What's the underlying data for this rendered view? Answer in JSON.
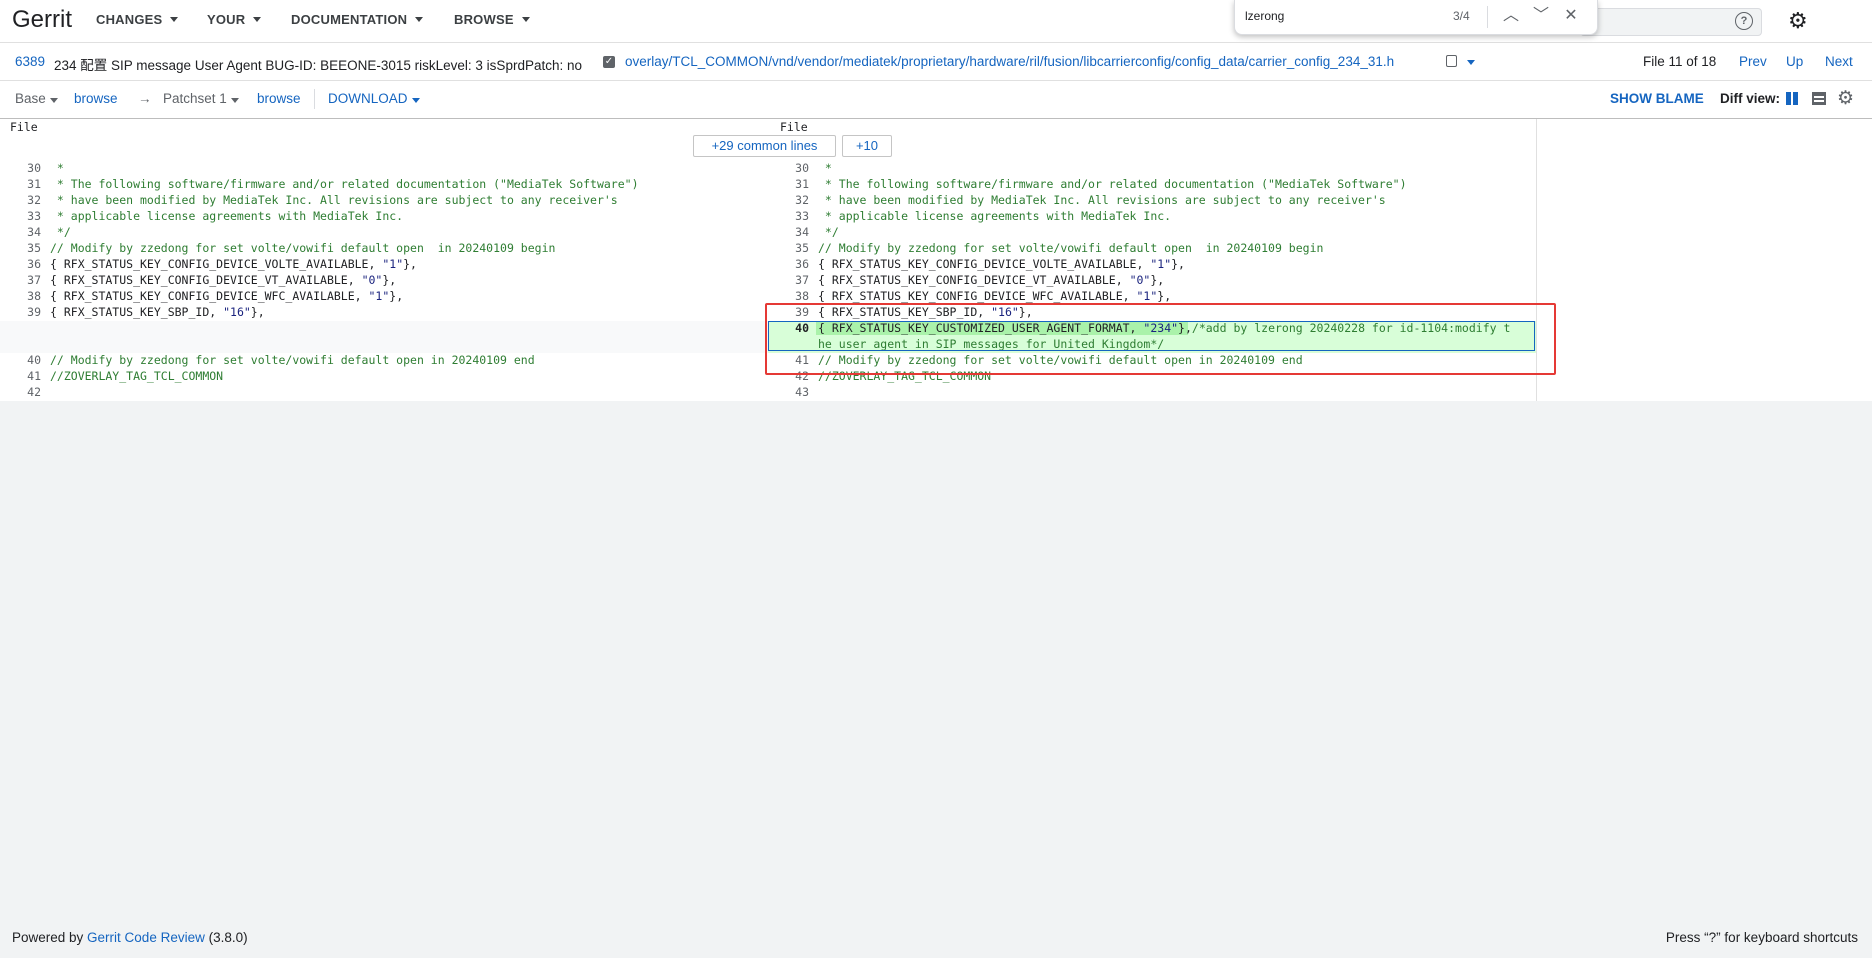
{
  "topbar": {
    "logo": "Gerrit",
    "menus": [
      "CHANGES",
      "YOUR",
      "DOCUMENTATION",
      "BROWSE"
    ]
  },
  "findbar": {
    "query": "lzerong",
    "count": "3/4"
  },
  "change": {
    "number": "6389",
    "subject": "234 配置 SIP message User Agent BUG-ID: BEEONE-3015 riskLevel: 3 isSprdPatch: no",
    "path": "overlay/TCL_COMMON/vnd/vendor/mediatek/proprietary/hardware/ril/fusion/libcarrierconfig/config_data/carrier_config_234_31.h",
    "file_of": "File 11 of 18",
    "nav": {
      "prev": "Prev",
      "up": "Up",
      "next": "Next"
    }
  },
  "patchbar": {
    "base": "Base",
    "browse1": "browse",
    "arrow": "→",
    "patchset": "Patchset 1",
    "browse2": "browse",
    "download": "DOWNLOAD",
    "blame": "SHOW BLAME",
    "diffview": "Diff view:"
  },
  "diff": {
    "file_left": "File",
    "file_right": "File",
    "common_lines": "+29 common lines",
    "more": "+10",
    "left_lines": [
      {
        "n": "30",
        "code": " *"
      },
      {
        "n": "31",
        "code": " * The following software/firmware and/or related documentation (\"MediaTek Software\")"
      },
      {
        "n": "32",
        "code": " * have been modified by MediaTek Inc. All revisions are subject to any receiver's"
      },
      {
        "n": "33",
        "code": " * applicable license agreements with MediaTek Inc."
      },
      {
        "n": "34",
        "code": " */"
      },
      {
        "n": "35",
        "code": "// Modify by zzedong for set volte/vowifi default open  in 20240109 begin"
      },
      {
        "n": "36",
        "code": "{ RFX_STATUS_KEY_CONFIG_DEVICE_VOLTE_AVAILABLE, \"1\"},"
      },
      {
        "n": "37",
        "code": "{ RFX_STATUS_KEY_CONFIG_DEVICE_VT_AVAILABLE, \"0\"},"
      },
      {
        "n": "38",
        "code": "{ RFX_STATUS_KEY_CONFIG_DEVICE_WFC_AVAILABLE, \"1\"},"
      },
      {
        "n": "39",
        "code": "{ RFX_STATUS_KEY_SBP_ID, \"16\"},"
      },
      {
        "n": "40",
        "code": "// Modify by zzedong for set volte/vowifi default open in 20240109 end"
      },
      {
        "n": "41",
        "code": "//ZOVERLAY_TAG_TCL_COMMON"
      },
      {
        "n": "42",
        "code": ""
      }
    ],
    "right_lines": [
      {
        "n": "30",
        "code": " *"
      },
      {
        "n": "31",
        "code": " * The following software/firmware and/or related documentation (\"MediaTek Software\")"
      },
      {
        "n": "32",
        "code": " * have been modified by MediaTek Inc. All revisions are subject to any receiver's"
      },
      {
        "n": "33",
        "code": " * applicable license agreements with MediaTek Inc."
      },
      {
        "n": "34",
        "code": " */"
      },
      {
        "n": "35",
        "code": "// Modify by zzedong for set volte/vowifi default open  in 20240109 begin"
      },
      {
        "n": "36",
        "code": "{ RFX_STATUS_KEY_CONFIG_DEVICE_VOLTE_AVAILABLE, \"1\"},"
      },
      {
        "n": "37",
        "code": "{ RFX_STATUS_KEY_CONFIG_DEVICE_VT_AVAILABLE, \"0\"},"
      },
      {
        "n": "38",
        "code": "{ RFX_STATUS_KEY_CONFIG_DEVICE_WFC_AVAILABLE, \"1\"},"
      },
      {
        "n": "39",
        "code": "{ RFX_STATUS_KEY_SBP_ID, \"16\"},"
      },
      {
        "n": "40",
        "code_a": "{ RFX_STATUS_KEY_CUSTOMIZED_USER_AGENT_FORMAT, ",
        "code_str": "\"234\"",
        "code_b": "},",
        "code_c": "/*add by lzerong 20240228 for id-1104:modify t",
        "code_d": "he user agent in SIP messages for United Kingdom*/"
      },
      {
        "n": "41",
        "code": "// Modify by zzedong for set volte/vowifi default open in 20240109 end"
      },
      {
        "n": "42",
        "code": "//ZOVERLAY_TAG_TCL_COMMON"
      },
      {
        "n": "43",
        "code": ""
      }
    ]
  },
  "footer": {
    "powered": "Powered by ",
    "link": "Gerrit Code Review",
    "version": " (3.8.0)",
    "shortcuts": "Press “?” for keyboard shortcuts"
  }
}
